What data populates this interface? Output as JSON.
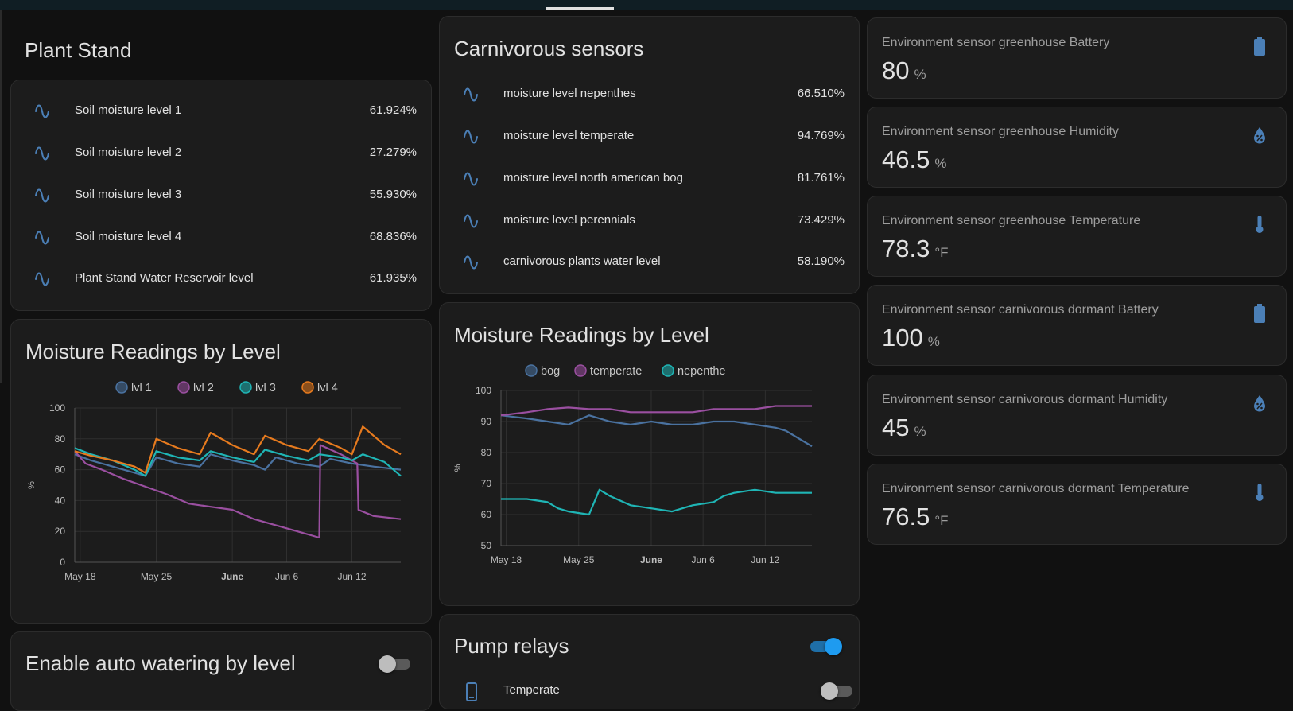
{
  "plant_stand": {
    "title": "Plant Stand",
    "rows": [
      {
        "name": "Soil moisture level 1",
        "value": "61.924%"
      },
      {
        "name": "Soil moisture level 2",
        "value": "27.279%"
      },
      {
        "name": "Soil moisture level 3",
        "value": "55.930%"
      },
      {
        "name": "Soil moisture level 4",
        "value": "68.836%"
      },
      {
        "name": "Plant Stand Water Reservoir level",
        "value": "61.935%"
      }
    ]
  },
  "carnivorous": {
    "title": "Carnivorous sensors",
    "rows": [
      {
        "name": "moisture level nepenthes",
        "value": "66.510%"
      },
      {
        "name": "moisture level temperate",
        "value": "94.769%"
      },
      {
        "name": "moisture level north american bog",
        "value": "81.761%"
      },
      {
        "name": "moisture level perennials",
        "value": "73.429%"
      },
      {
        "name": "carnivorous plants water level",
        "value": "58.190%"
      }
    ]
  },
  "chart_left_title": "Moisture Readings by Level",
  "chart_right_title": "Moisture Readings by Level",
  "chart_data": [
    {
      "type": "line",
      "title": "Moisture Readings by Level",
      "ylabel": "%",
      "ylim": [
        0,
        100
      ],
      "yticks": [
        0,
        20,
        40,
        60,
        80,
        100
      ],
      "xticks": [
        {
          "label": "May 18",
          "day": 0,
          "bold": false
        },
        {
          "label": "May 25",
          "day": 7,
          "bold": false
        },
        {
          "label": "June",
          "day": 14,
          "bold": true
        },
        {
          "label": "Jun 6",
          "day": 19,
          "bold": false
        },
        {
          "label": "Jun 12",
          "day": 25,
          "bold": false
        }
      ],
      "xlim_days": [
        -0.5,
        29.5
      ],
      "legend_position": "top",
      "series": [
        {
          "name": "lvl 1",
          "color": "#4a72a0",
          "points": [
            [
              -0.5,
              70
            ],
            [
              1,
              66
            ],
            [
              3,
              62
            ],
            [
              5,
              58
            ],
            [
              6,
              56
            ],
            [
              7,
              68
            ],
            [
              9,
              64
            ],
            [
              11,
              62
            ],
            [
              12,
              70
            ],
            [
              14,
              66
            ],
            [
              16,
              63
            ],
            [
              17,
              60
            ],
            [
              18,
              68
            ],
            [
              20,
              64
            ],
            [
              22,
              62
            ],
            [
              23,
              67
            ],
            [
              25,
              64
            ],
            [
              27,
              62
            ],
            [
              29.5,
              60
            ]
          ]
        },
        {
          "name": "lvl 2",
          "color": "#9a4fa0",
          "points": [
            [
              -0.5,
              72
            ],
            [
              0.5,
              64
            ],
            [
              2,
              60
            ],
            [
              4,
              54
            ],
            [
              6,
              49
            ],
            [
              8,
              44
            ],
            [
              10,
              38
            ],
            [
              12,
              36
            ],
            [
              14,
              34
            ],
            [
              16,
              28
            ],
            [
              18,
              24
            ],
            [
              20,
              20
            ],
            [
              22,
              16
            ],
            [
              22.1,
              76
            ],
            [
              24,
              70
            ],
            [
              25.5,
              64
            ],
            [
              25.6,
              34
            ],
            [
              27,
              30
            ],
            [
              29.5,
              28
            ]
          ]
        },
        {
          "name": "lvl 3",
          "color": "#1fb5b5",
          "points": [
            [
              -0.5,
              74
            ],
            [
              1,
              70
            ],
            [
              3,
              66
            ],
            [
              5,
              60
            ],
            [
              6,
              56
            ],
            [
              7,
              72
            ],
            [
              9,
              68
            ],
            [
              11,
              66
            ],
            [
              12,
              72
            ],
            [
              14,
              68
            ],
            [
              16,
              65
            ],
            [
              17,
              73
            ],
            [
              19,
              69
            ],
            [
              21,
              66
            ],
            [
              22,
              70
            ],
            [
              24,
              68
            ],
            [
              25,
              66
            ],
            [
              26,
              70
            ],
            [
              28,
              65
            ],
            [
              29.5,
              56
            ]
          ]
        },
        {
          "name": "lvl 4",
          "color": "#e67a1e",
          "points": [
            [
              -0.5,
              72
            ],
            [
              1,
              69
            ],
            [
              3,
              66
            ],
            [
              5,
              62
            ],
            [
              6,
              58
            ],
            [
              7,
              80
            ],
            [
              9,
              74
            ],
            [
              11,
              70
            ],
            [
              12,
              84
            ],
            [
              14,
              76
            ],
            [
              16,
              70
            ],
            [
              17,
              82
            ],
            [
              19,
              76
            ],
            [
              21,
              72
            ],
            [
              22,
              80
            ],
            [
              24,
              74
            ],
            [
              25,
              70
            ],
            [
              26,
              88
            ],
            [
              28,
              76
            ],
            [
              29.5,
              70
            ]
          ]
        }
      ]
    },
    {
      "type": "line",
      "title": "Moisture Readings by Level",
      "ylabel": "%",
      "ylim": [
        50,
        100
      ],
      "yticks": [
        50,
        60,
        70,
        80,
        90,
        100
      ],
      "xticks": [
        {
          "label": "May 18",
          "day": 0,
          "bold": false
        },
        {
          "label": "May 25",
          "day": 7,
          "bold": false
        },
        {
          "label": "June",
          "day": 14,
          "bold": true
        },
        {
          "label": "Jun 6",
          "day": 19,
          "bold": false
        },
        {
          "label": "Jun 12",
          "day": 25,
          "bold": false
        }
      ],
      "xlim_days": [
        -0.5,
        29.5
      ],
      "legend_position": "top",
      "series": [
        {
          "name": "bog",
          "color": "#4a72a0",
          "points": [
            [
              -0.5,
              92
            ],
            [
              2,
              91
            ],
            [
              4,
              90
            ],
            [
              6,
              89
            ],
            [
              8,
              92
            ],
            [
              10,
              90
            ],
            [
              12,
              89
            ],
            [
              14,
              90
            ],
            [
              16,
              89
            ],
            [
              18,
              89
            ],
            [
              20,
              90
            ],
            [
              22,
              90
            ],
            [
              24,
              89
            ],
            [
              26,
              88
            ],
            [
              27,
              87
            ],
            [
              28,
              85
            ],
            [
              29.5,
              82
            ]
          ]
        },
        {
          "name": "temperate",
          "color": "#9a4fa0",
          "points": [
            [
              -0.5,
              92
            ],
            [
              2,
              93
            ],
            [
              4,
              94
            ],
            [
              6,
              94.5
            ],
            [
              8,
              94
            ],
            [
              10,
              94
            ],
            [
              12,
              93
            ],
            [
              14,
              93
            ],
            [
              16,
              93
            ],
            [
              18,
              93
            ],
            [
              20,
              94
            ],
            [
              22,
              94
            ],
            [
              24,
              94
            ],
            [
              26,
              95
            ],
            [
              28,
              95
            ],
            [
              29.5,
              95
            ]
          ]
        },
        {
          "name": "nepenthe",
          "color": "#1fb5b5",
          "points": [
            [
              -0.5,
              65
            ],
            [
              2,
              65
            ],
            [
              4,
              64
            ],
            [
              5,
              62
            ],
            [
              6,
              61
            ],
            [
              8,
              60
            ],
            [
              9,
              68
            ],
            [
              10,
              66
            ],
            [
              12,
              63
            ],
            [
              14,
              62
            ],
            [
              16,
              61
            ],
            [
              18,
              63
            ],
            [
              20,
              64
            ],
            [
              21,
              66
            ],
            [
              22,
              67
            ],
            [
              24,
              68
            ],
            [
              26,
              67
            ],
            [
              28,
              67
            ],
            [
              29.5,
              67
            ]
          ]
        }
      ]
    }
  ],
  "sensors": [
    {
      "name": "Environment sensor greenhouse Battery",
      "value": "80",
      "unit": "%",
      "icon": "battery-icon"
    },
    {
      "name": "Environment sensor greenhouse Humidity",
      "value": "46.5",
      "unit": "%",
      "icon": "humidity-icon"
    },
    {
      "name": "Environment sensor greenhouse Temperature",
      "value": "78.3",
      "unit": "°F",
      "icon": "thermometer-icon"
    },
    {
      "name": "Environment sensor carnivorous dormant Battery",
      "value": "100",
      "unit": "%",
      "icon": "battery-icon"
    },
    {
      "name": "Environment sensor carnivorous dormant Humidity",
      "value": "45",
      "unit": "%",
      "icon": "humidity-icon"
    },
    {
      "name": "Environment sensor carnivorous dormant Temperature",
      "value": "76.5",
      "unit": "°F",
      "icon": "thermometer-icon"
    }
  ],
  "auto_watering": {
    "title": "Enable auto watering by level",
    "enabled": false
  },
  "pump_relays": {
    "title": "Pump relays",
    "enabled": true,
    "rows": [
      {
        "name": "Temperate",
        "enabled": false
      }
    ]
  },
  "colors": {
    "accent": "#1e9bf0",
    "icon_blue": "#4b7fb6"
  }
}
